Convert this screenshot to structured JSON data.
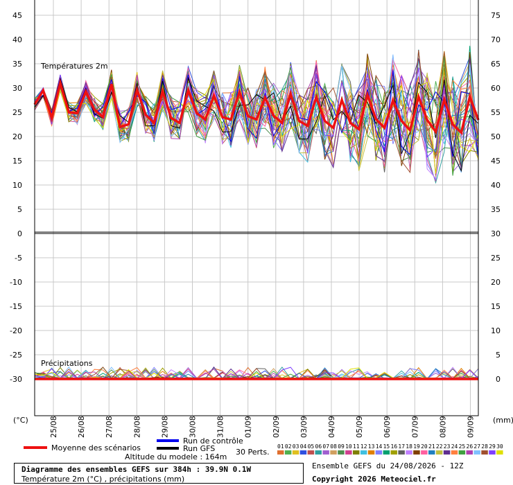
{
  "chart_data": {
    "type": "line",
    "title": "Diagramme des ensembles GEFS sur 384h : 39.9N 0.1W",
    "subtitle": "Température 2m (°C) , précipitations (mm)",
    "altitude": "Altitude du modele : 164m",
    "ensemble_label": "Ensemble GEFS du 24/08/2026 - 12Z",
    "copyright": "Copyright 2026 Meteociel.fr",
    "left_unit": "(°C)",
    "right_unit": "(mm)",
    "temp_panel_label": "Températures 2m",
    "precip_panel_label": "Précipitations",
    "left_ticks": [
      45,
      40,
      35,
      30,
      25,
      20,
      15,
      10,
      5,
      0,
      -5,
      -10,
      -15,
      -20,
      -25,
      -30
    ],
    "right_ticks_temp": [
      75,
      70,
      65,
      60,
      55,
      50,
      45,
      40,
      35,
      30
    ],
    "right_ticks_precip": [
      25,
      20,
      15,
      10,
      5,
      0
    ],
    "dates": [
      "25/08",
      "26/08",
      "27/08",
      "28/08",
      "29/08",
      "30/08",
      "31/08",
      "01/09",
      "02/09",
      "03/09",
      "04/09",
      "05/09",
      "06/09",
      "07/09",
      "08/09",
      "09/09"
    ],
    "legend": {
      "mean": "Moyenne des scénarios",
      "control": "Run de contrôle",
      "gfs": "Run GFS",
      "perts": "30 Perts."
    },
    "pert_labels": [
      "01",
      "02",
      "03",
      "04",
      "05",
      "06",
      "07",
      "08",
      "09",
      "10",
      "11",
      "12",
      "13",
      "14",
      "15",
      "16",
      "17",
      "18",
      "19",
      "20",
      "21",
      "22",
      "23",
      "24",
      "25",
      "26",
      "27",
      "28",
      "29",
      "30"
    ],
    "pert_colors": [
      "#e07030",
      "#50b050",
      "#e0c020",
      "#3050e0",
      "#c05050",
      "#30a0a0",
      "#a060d0",
      "#d0a060",
      "#509050",
      "#d04090",
      "#808000",
      "#40c0e0",
      "#e08000",
      "#8080ff",
      "#00a070",
      "#a0a000",
      "#606060",
      "#c080ff",
      "#804000",
      "#ff60a0",
      "#2080c0",
      "#c0c040",
      "#603090",
      "#ff8040",
      "#40a040",
      "#b040b0",
      "#80c0ff",
      "#a05030",
      "#8040ff",
      "#e0e000"
    ],
    "mean_color": "#ee1111",
    "control_color": "#0000ee",
    "gfs_color": "#000000",
    "ylim_temp": [
      0,
      47
    ],
    "ylim_precip": [
      -35,
      0
    ],
    "series": [
      {
        "name": "Moyenne des scénarios",
        "kind": "temperature",
        "values": [
          26.6,
          29.5,
          23.8,
          31.0,
          25.0,
          24.8,
          29.3,
          25.5,
          24.0,
          30.8,
          22.0,
          22.5,
          29.6,
          24.5,
          22.8,
          29.3,
          23.8,
          22.8,
          29.6,
          24.8,
          23.5,
          28.4,
          24.0,
          23.5,
          29.2,
          24.2,
          23.5,
          28.0,
          24.3,
          22.8,
          28.8,
          23.2,
          22.2,
          28.1,
          23.2,
          21.8,
          27.5,
          22.8,
          21.5,
          28.6,
          23.6,
          21.8,
          27.4,
          23.2,
          21.3,
          28.2,
          23.4,
          21.0,
          27.6,
          22.5,
          20.8,
          28.2,
          23.4
        ]
      }
    ]
  }
}
